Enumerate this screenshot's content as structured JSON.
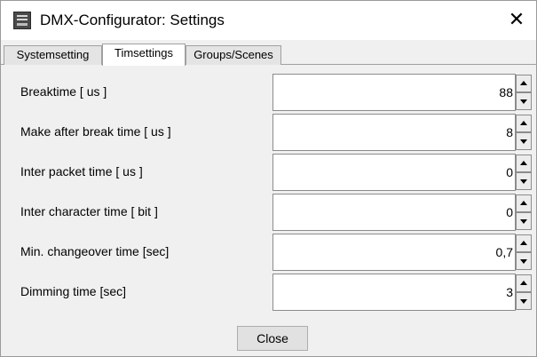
{
  "window": {
    "title": "DMX-Configurator: Settings",
    "app_icon": "dmx-app-icon",
    "close_glyph": "✕"
  },
  "tabs": [
    {
      "label": "Systemsetting",
      "active": false
    },
    {
      "label": "Timsettings",
      "active": true
    },
    {
      "label": "Groups/Scenes",
      "active": false
    }
  ],
  "settings": [
    {
      "label": "Breaktime [ us ]",
      "value": "88"
    },
    {
      "label": "Make after break time [ us ]",
      "value": "8"
    },
    {
      "label": "Inter packet time [ us ]",
      "value": "0"
    },
    {
      "label": "Inter character time [ bit ]",
      "value": "0"
    },
    {
      "label": "Min. changeover time [sec]",
      "value": "0,7"
    },
    {
      "label": "Dimming time [sec]",
      "value": "3"
    }
  ],
  "footer": {
    "close_label": "Close"
  }
}
